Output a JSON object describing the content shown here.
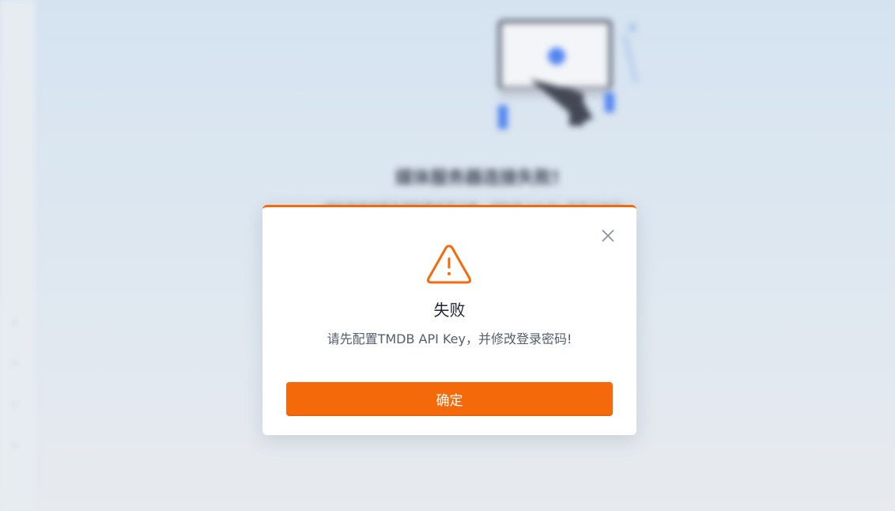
{
  "background": {
    "title": "媒体服务器连接失败!",
    "subtitle": "请检查媒体服务器配置是否正确，或检查 Jellyfin 是否已启动。",
    "sidebar_icons": [
      "chevron-down-icon",
      "chevron-down-icon",
      "chevron-down-icon",
      "chevron-down-icon"
    ]
  },
  "dialog": {
    "accent_color": "#f46a0b",
    "icon": "warning-triangle-icon",
    "title": "失败",
    "message": "请先配置TMDB API Key，并修改登录密码!",
    "confirm_label": "确定",
    "close_icon": "close-icon"
  }
}
